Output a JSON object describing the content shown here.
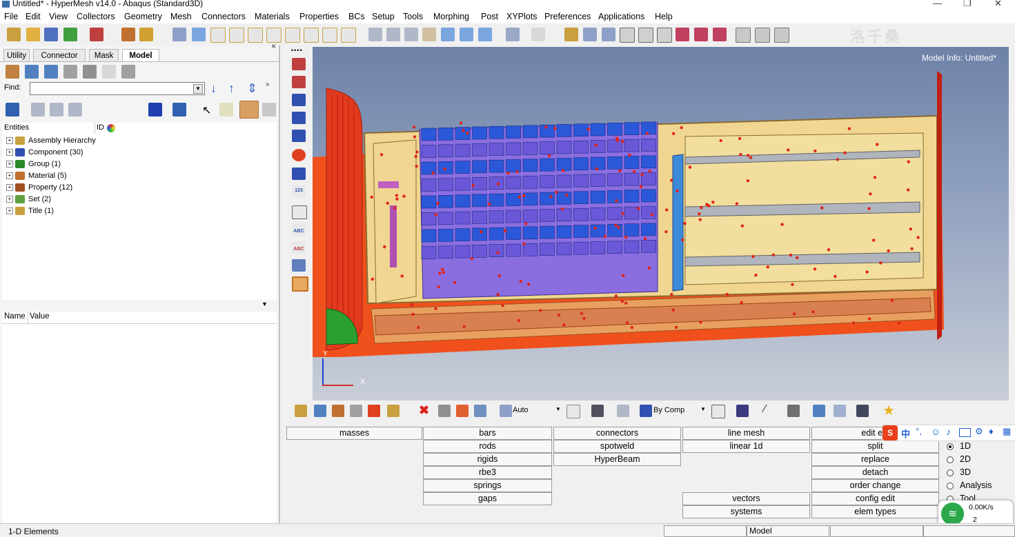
{
  "window": {
    "title": "Untitled* - HyperMesh v14.0 - Abaqus (Standard3D)",
    "min": "—",
    "max": "❐",
    "close": "✕"
  },
  "menu": [
    "File",
    "Edit",
    "View",
    "Collectors",
    "Geometry",
    "Mesh",
    "Connectors",
    "Materials",
    "Properties",
    "BCs",
    "Setup",
    "Tools",
    "Morphing",
    "Post",
    "XYPlots",
    "Preferences",
    "Applications",
    "Help"
  ],
  "watermark": "洛千桑",
  "tabs": [
    "Utility",
    "Connector",
    "Mask",
    "Model"
  ],
  "active_tab": "Model",
  "find_label": "Find:",
  "entities_header": {
    "col1": "Entities",
    "col2": "ID"
  },
  "tree": [
    {
      "label": "Assembly Hierarchy",
      "color": "#c8a040"
    },
    {
      "label": "Component (30)",
      "color": "#3050b0"
    },
    {
      "label": "Group (1)",
      "color": "#2a8a2a"
    },
    {
      "label": "Material (5)",
      "color": "#c07030"
    },
    {
      "label": "Property (12)",
      "color": "#a05020"
    },
    {
      "label": "Set (2)",
      "color": "#60a040"
    },
    {
      "label": "Title (1)",
      "color": "#c8a040"
    }
  ],
  "nv_header": {
    "name": "Name",
    "value": "Value"
  },
  "viewport": {
    "model_info": "Model Info: Untitled*",
    "axis_y": "Y",
    "axis_x": "X"
  },
  "bottom_strip": {
    "auto_label": "Auto",
    "bycomp_label": "By Comp"
  },
  "panel": {
    "col1": [
      "masses"
    ],
    "col2": [
      "bars",
      "rods",
      "rigids",
      "rbe3",
      "springs",
      "gaps"
    ],
    "col3": [
      "connectors",
      "spotweld",
      "HyperBeam"
    ],
    "col4": [
      "line mesh",
      "linear 1d",
      "vectors",
      "systems"
    ],
    "col5": [
      "edit ele",
      "split",
      "replace",
      "detach",
      "order change",
      "config edit",
      "elem types"
    ],
    "radios": [
      "1D",
      "2D",
      "3D",
      "Analysis",
      "Tool"
    ],
    "selected_radio": "1D"
  },
  "ime": {
    "lang": "中"
  },
  "network": {
    "speed": "0.00K/s",
    "count": "2"
  },
  "status": {
    "left": "1-D Elements",
    "mid": "Model"
  },
  "colors": {
    "accent_red": "#e23a1e",
    "component_blue": "#2a58d8",
    "component_purple": "#8a6ee0",
    "tan": "#e8c878",
    "orange_plate": "#f0501c"
  }
}
